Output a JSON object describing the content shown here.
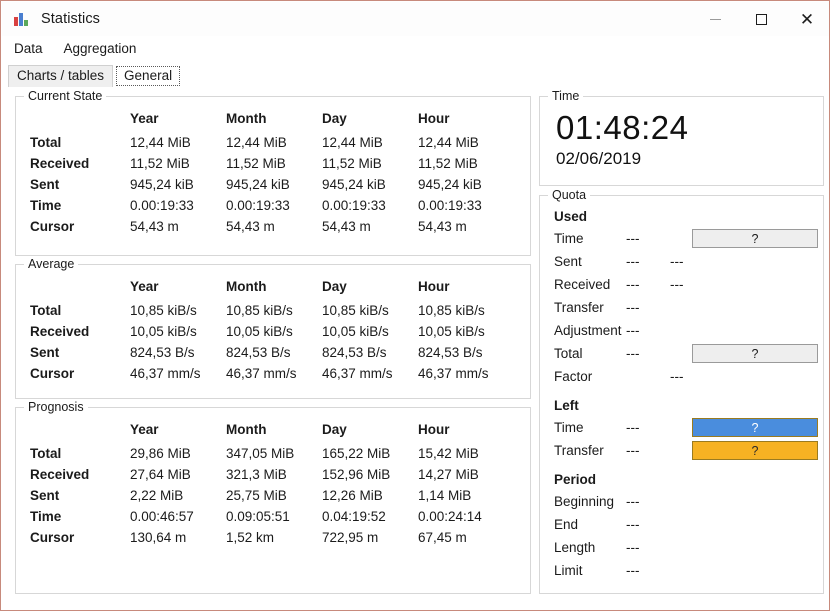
{
  "window": {
    "title": "Statistics",
    "icon": "bar-chart-icon",
    "controls": {
      "minimize": "–",
      "maximize": "□",
      "close": "✕"
    },
    "border_color": "#c78a7c"
  },
  "menu": {
    "items": [
      "Data",
      "Aggregation"
    ]
  },
  "tabs": {
    "items": [
      {
        "label": "Charts / tables",
        "active": false
      },
      {
        "label": "General",
        "active": true
      }
    ]
  },
  "columns": [
    "Year",
    "Month",
    "Day",
    "Hour"
  ],
  "current_state": {
    "title": "Current State",
    "rows": [
      {
        "label": "Total",
        "values": [
          "12,44 MiB",
          "12,44 MiB",
          "12,44 MiB",
          "12,44 MiB"
        ]
      },
      {
        "label": "Received",
        "values": [
          "11,52 MiB",
          "11,52 MiB",
          "11,52 MiB",
          "11,52 MiB"
        ]
      },
      {
        "label": "Sent",
        "values": [
          "945,24 kiB",
          "945,24 kiB",
          "945,24 kiB",
          "945,24 kiB"
        ]
      },
      {
        "label": "Time",
        "values": [
          "0.00:19:33",
          "0.00:19:33",
          "0.00:19:33",
          "0.00:19:33"
        ]
      },
      {
        "label": "Cursor",
        "values": [
          "54,43 m",
          "54,43 m",
          "54,43 m",
          "54,43 m"
        ]
      }
    ]
  },
  "average": {
    "title": "Average",
    "rows": [
      {
        "label": "Total",
        "values": [
          "10,85 kiB/s",
          "10,85 kiB/s",
          "10,85 kiB/s",
          "10,85 kiB/s"
        ]
      },
      {
        "label": "Received",
        "values": [
          "10,05 kiB/s",
          "10,05 kiB/s",
          "10,05 kiB/s",
          "10,05 kiB/s"
        ]
      },
      {
        "label": "Sent",
        "values": [
          "824,53 B/s",
          "824,53 B/s",
          "824,53 B/s",
          "824,53 B/s"
        ]
      },
      {
        "label": "Cursor",
        "values": [
          "46,37 mm/s",
          "46,37 mm/s",
          "46,37 mm/s",
          "46,37 mm/s"
        ]
      }
    ]
  },
  "prognosis": {
    "title": "Prognosis",
    "rows": [
      {
        "label": "Total",
        "values": [
          "29,86 MiB",
          "347,05 MiB",
          "165,22 MiB",
          "15,42 MiB"
        ]
      },
      {
        "label": "Received",
        "values": [
          "27,64 MiB",
          "321,3 MiB",
          "152,96 MiB",
          "14,27 MiB"
        ]
      },
      {
        "label": "Sent",
        "values": [
          "2,22 MiB",
          "25,75 MiB",
          "12,26 MiB",
          "1,14 MiB"
        ]
      },
      {
        "label": "Time",
        "values": [
          "0.00:46:57",
          "0.09:05:51",
          "0.04:19:52",
          "0.00:24:14"
        ]
      },
      {
        "label": "Cursor",
        "values": [
          "130,64 m",
          "1,52 km",
          "722,95 m",
          "67,45 m"
        ]
      }
    ]
  },
  "time_panel": {
    "title": "Time",
    "clock": "01:48:24",
    "date": "02/06/2019"
  },
  "quota": {
    "title": "Quota",
    "sections": [
      {
        "heading": "Used",
        "rows": [
          {
            "label": "Time",
            "v1": "---",
            "v2": "",
            "bar": {
              "text": "?",
              "style": "gray"
            }
          },
          {
            "label": "Sent",
            "v1": "---",
            "v2": "---",
            "bar": null
          },
          {
            "label": "Received",
            "v1": "---",
            "v2": "---",
            "bar": null
          },
          {
            "label": "Transfer",
            "v1": "---",
            "v2": "",
            "bar": null
          },
          {
            "label": "Adjustment",
            "v1": "---",
            "v2": "",
            "bar": null
          },
          {
            "label": "Total",
            "v1": "---",
            "v2": "",
            "bar": {
              "text": "?",
              "style": "gray"
            }
          },
          {
            "label": "Factor",
            "v1": "",
            "v2": "---",
            "bar": null
          }
        ]
      },
      {
        "heading": "Left",
        "rows": [
          {
            "label": "Time",
            "v1": "---",
            "v2": "",
            "bar": {
              "text": "?",
              "style": "blue"
            }
          },
          {
            "label": "Transfer",
            "v1": "---",
            "v2": "",
            "bar": {
              "text": "?",
              "style": "amber"
            }
          }
        ]
      },
      {
        "heading": "Period",
        "rows": [
          {
            "label": "Beginning",
            "v1": "---",
            "v2": "",
            "bar": null
          },
          {
            "label": "End",
            "v1": "---",
            "v2": "",
            "bar": null
          },
          {
            "label": "Length",
            "v1": "---",
            "v2": "",
            "bar": null
          },
          {
            "label": "Limit",
            "v1": "---",
            "v2": "",
            "bar": null
          }
        ]
      }
    ],
    "colors": {
      "blue": "#4a8ddd",
      "amber": "#f6b223",
      "gray": "#eeeeee"
    }
  }
}
